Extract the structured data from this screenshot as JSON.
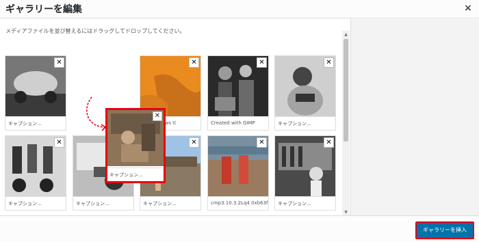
{
  "header": {
    "title": "ギャラリーを編集",
    "close_label": "×"
  },
  "instructions": "メディアファイルを並び替えるにはドラッグしてドロップしてください。",
  "thumbnails": [
    {
      "caption": "キャプション..."
    },
    {
      "caption": "y set shows tl"
    },
    {
      "caption": "Created with GIMP"
    },
    {
      "caption": "キャプション..."
    },
    {
      "caption": "キャプション..."
    },
    {
      "caption": "キャプション..."
    },
    {
      "caption": "キャプション..."
    },
    {
      "caption": "cmp3.10.3.2Lq4 0xb63f"
    },
    {
      "caption": "キャプション..."
    }
  ],
  "dragging_thumb": {
    "caption": "キャプション..."
  },
  "remove_label": "✕",
  "footer": {
    "insert_button": "ギャラリーを挿入"
  },
  "colors": {
    "accent": "#0073aa",
    "highlight": "#e60012"
  }
}
